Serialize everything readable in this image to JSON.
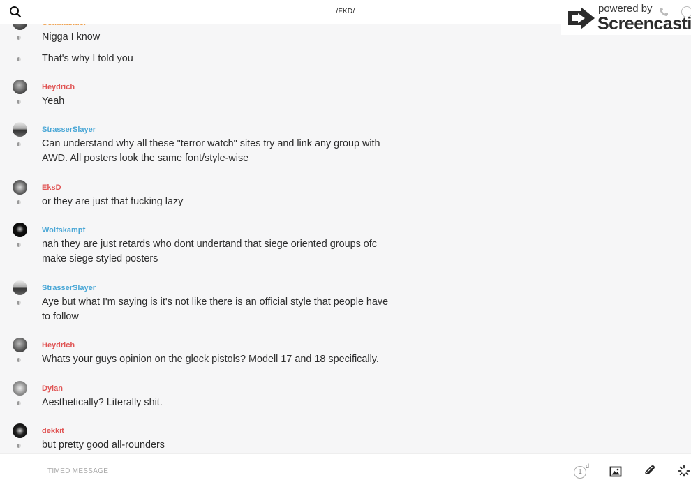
{
  "header": {
    "title": "/FKD/"
  },
  "watermark": {
    "powered": "powered by",
    "brand": "Screencastify"
  },
  "messages": [
    {
      "author": "Commander",
      "author_color": "#f0a04b",
      "text": "Nigga I know"
    },
    {
      "author": "",
      "text": "That's why I told you"
    },
    {
      "author": "Heydrich",
      "author_color": "#e05555",
      "text": "Yeah"
    },
    {
      "author": "StrasserSlayer",
      "author_color": "#4aa7d6",
      "text": "Can understand why all these \"terror watch\" sites try and link any group with AWD. All posters look the same font/style-wise"
    },
    {
      "author": "EksD",
      "author_color": "#e05555",
      "text": "or they are just that fucking lazy"
    },
    {
      "author": "Wolfskampf",
      "author_color": "#4aa7d6",
      "text": "nah they are just retards who dont  undertand that siege oriented groups ofc make siege styled posters"
    },
    {
      "author": "StrasserSlayer",
      "author_color": "#4aa7d6",
      "text": "Aye but what I'm saying is it's not like there is an official style that people have to follow"
    },
    {
      "author": "Heydrich",
      "author_color": "#e05555",
      "text": "Whats your guys opinion on the glock pistols? Modell 17 and 18 specifically."
    },
    {
      "author": "Dylan",
      "author_color": "#e05555",
      "text": "Aesthetically? Literally shit."
    },
    {
      "author": "dekkit",
      "author_color": "#e05555",
      "text": "but pretty good all-rounders"
    }
  ],
  "composer": {
    "placeholder": "TIMED MESSAGE",
    "timer_value": "1",
    "timer_unit": "d"
  },
  "icons": [
    "search-icon",
    "phone-icon",
    "info-icon",
    "timer-icon",
    "image-icon",
    "paperclip-icon",
    "spinner-icon"
  ]
}
